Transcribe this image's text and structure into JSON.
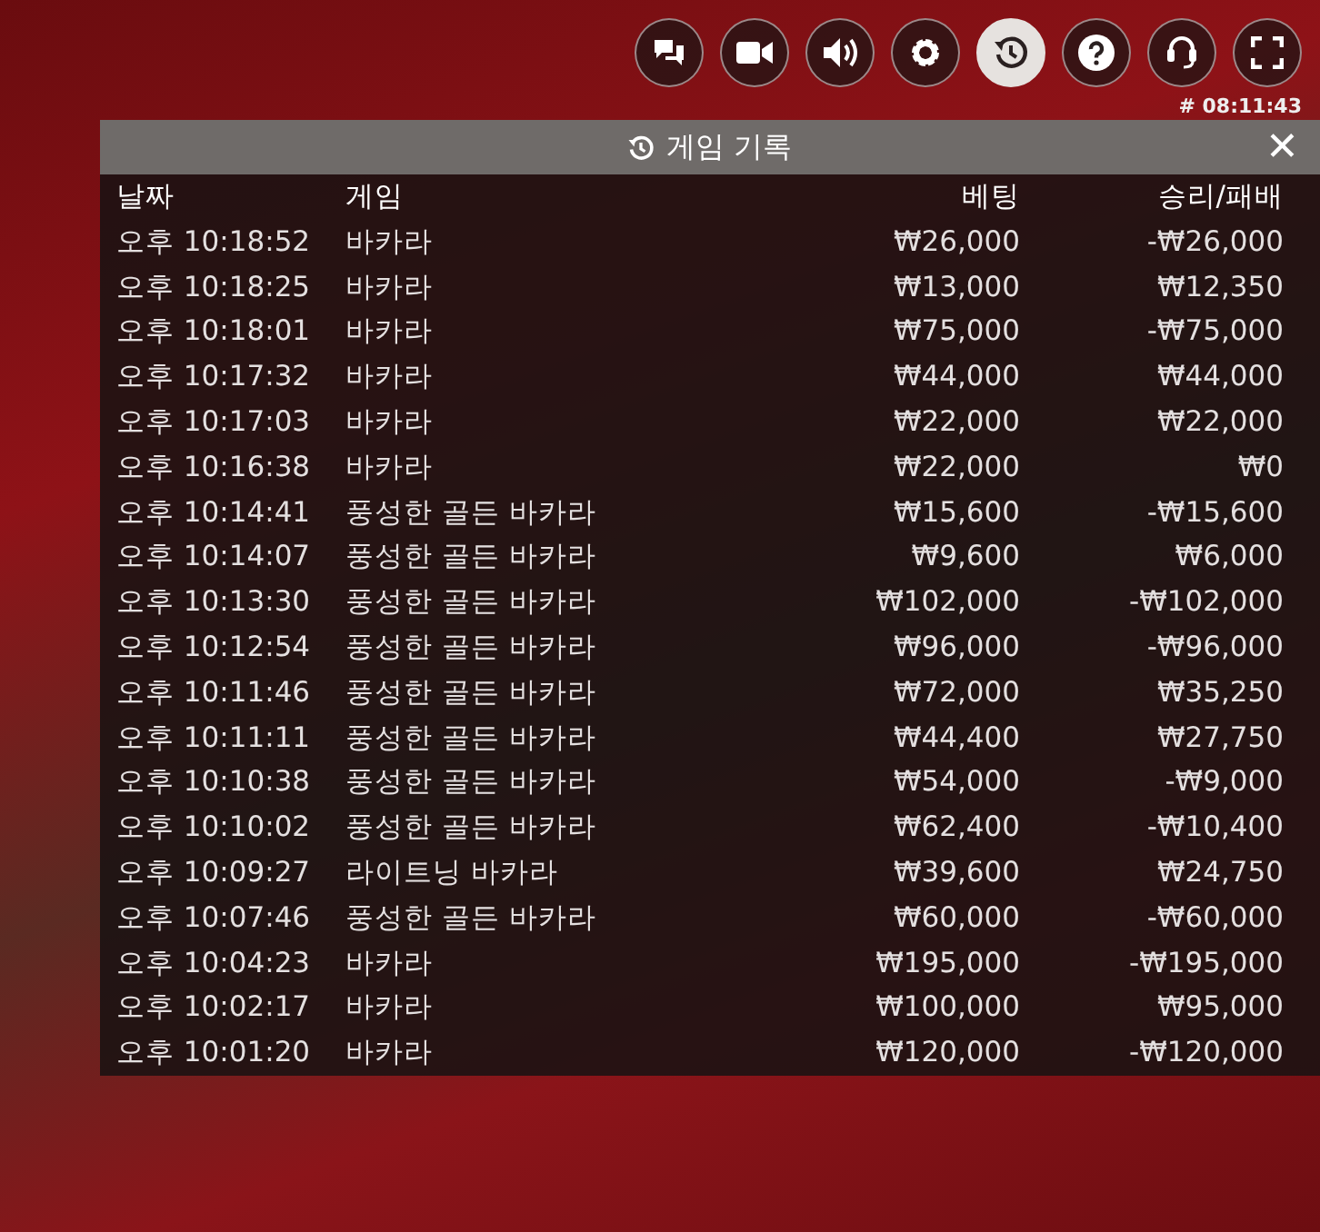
{
  "toolbar": [
    {
      "kind": "chat",
      "selected": false
    },
    {
      "kind": "video",
      "selected": false
    },
    {
      "kind": "sound",
      "selected": false
    },
    {
      "kind": "settings",
      "selected": false
    },
    {
      "kind": "history",
      "selected": true
    },
    {
      "kind": "help",
      "selected": false
    },
    {
      "kind": "support",
      "selected": false
    },
    {
      "kind": "fullscreen",
      "selected": false
    }
  ],
  "round_id": "# 08:11:43",
  "panel": {
    "title": "게임 기록",
    "close": "✕"
  },
  "table": {
    "columns": [
      "날짜",
      "게임",
      "베팅",
      "승리/패배"
    ],
    "rows": [
      [
        "오후 10:18:52",
        "바카라",
        "₩26,000",
        "-₩26,000"
      ],
      [
        "오후 10:18:25",
        "바카라",
        "₩13,000",
        "₩12,350"
      ],
      [
        "오후 10:18:01",
        "바카라",
        "₩75,000",
        "-₩75,000"
      ],
      [
        "오후 10:17:32",
        "바카라",
        "₩44,000",
        "₩44,000"
      ],
      [
        "오후 10:17:03",
        "바카라",
        "₩22,000",
        "₩22,000"
      ],
      [
        "오후 10:16:38",
        "바카라",
        "₩22,000",
        "₩0"
      ],
      [
        "오후 10:14:41",
        "풍성한 골든 바카라",
        "₩15,600",
        "-₩15,600"
      ],
      [
        "오후 10:14:07",
        "풍성한 골든 바카라",
        "₩9,600",
        "₩6,000"
      ],
      [
        "오후 10:13:30",
        "풍성한 골든 바카라",
        "₩102,000",
        "-₩102,000"
      ],
      [
        "오후 10:12:54",
        "풍성한 골든 바카라",
        "₩96,000",
        "-₩96,000"
      ],
      [
        "오후 10:11:46",
        "풍성한 골든 바카라",
        "₩72,000",
        "₩35,250"
      ],
      [
        "오후 10:11:11",
        "풍성한 골든 바카라",
        "₩44,400",
        "₩27,750"
      ],
      [
        "오후 10:10:38",
        "풍성한 골든 바카라",
        "₩54,000",
        "-₩9,000"
      ],
      [
        "오후 10:10:02",
        "풍성한 골든 바카라",
        "₩62,400",
        "-₩10,400"
      ],
      [
        "오후 10:09:27",
        "라이트닝 바카라",
        "₩39,600",
        "₩24,750"
      ],
      [
        "오후 10:07:46",
        "풍성한 골든 바카라",
        "₩60,000",
        "-₩60,000"
      ],
      [
        "오후 10:04:23",
        "바카라",
        "₩195,000",
        "-₩195,000"
      ],
      [
        "오후 10:02:17",
        "바카라",
        "₩100,000",
        "₩95,000"
      ],
      [
        "오후 10:01:20",
        "바카라",
        "₩120,000",
        "-₩120,000"
      ]
    ]
  }
}
